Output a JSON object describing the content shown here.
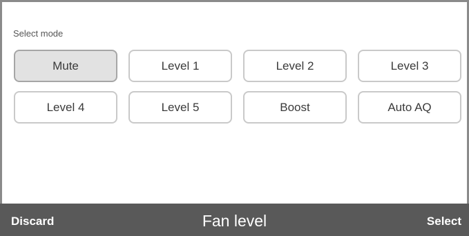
{
  "section_label": "Select mode",
  "modes": [
    {
      "label": "Mute",
      "selected": true
    },
    {
      "label": "Level 1",
      "selected": false
    },
    {
      "label": "Level 2",
      "selected": false
    },
    {
      "label": "Level 3",
      "selected": false
    },
    {
      "label": "Level 4",
      "selected": false
    },
    {
      "label": "Level 5",
      "selected": false
    },
    {
      "label": "Boost",
      "selected": false
    },
    {
      "label": "Auto AQ",
      "selected": false
    }
  ],
  "footer": {
    "discard_label": "Discard",
    "title": "Fan level",
    "select_label": "Select"
  },
  "colors": {
    "footer_bg": "#595959",
    "selected_bg": "#e2e2e2",
    "button_border": "#c9c9c9"
  }
}
